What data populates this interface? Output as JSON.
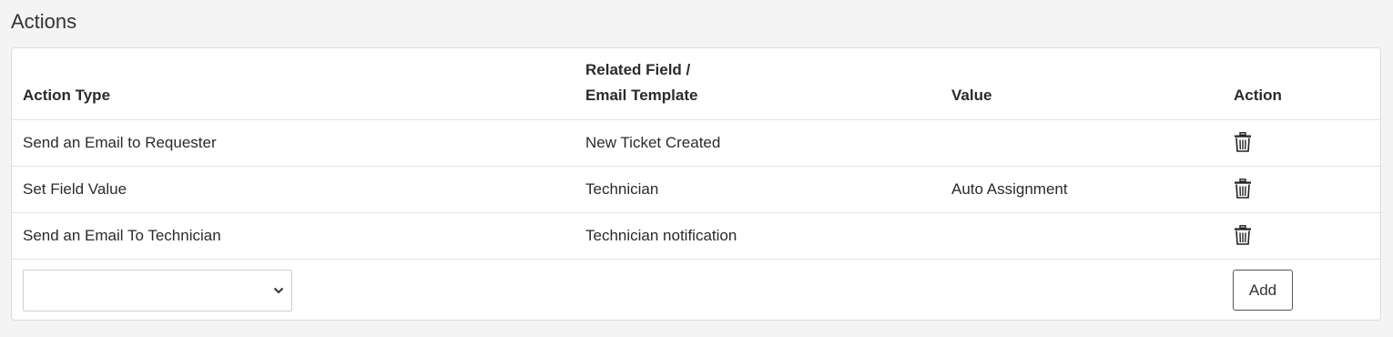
{
  "section": {
    "title": "Actions"
  },
  "table": {
    "headers": {
      "action_type": "Action Type",
      "related_field_line1": "Related Field /",
      "related_field_line2": "Email Template",
      "value": "Value",
      "action": "Action"
    },
    "rows": [
      {
        "action_type": "Send an Email to Requester",
        "related": "New Ticket Created",
        "value": "",
        "action_icon": "trash-icon"
      },
      {
        "action_type": "Set Field Value",
        "related": "Technician",
        "value": "Auto Assignment",
        "action_icon": "trash-icon"
      },
      {
        "action_type": "Send an Email To Technician",
        "related": "Technician notification",
        "value": "",
        "action_icon": "trash-icon"
      }
    ]
  },
  "new_action": {
    "select_value": "",
    "select_icon": "chevron-down-icon",
    "add_label": "Add"
  }
}
